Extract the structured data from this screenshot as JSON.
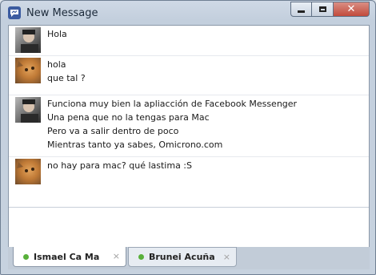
{
  "window": {
    "title": "New Message"
  },
  "window_controls": {
    "close_label": "✕"
  },
  "messages": [
    {
      "avatar": "person",
      "lines": [
        "Hola"
      ]
    },
    {
      "avatar": "cat",
      "lines": [
        "hola",
        "que tal ?"
      ]
    },
    {
      "avatar": "person",
      "lines": [
        "Funciona muy bien la apliacción de Facebook Messenger",
        "Una pena que no la tengas para Mac",
        "Pero va a salir dentro de poco",
        "Mientras tanto ya sabes, Omicrono.com"
      ]
    },
    {
      "avatar": "cat",
      "lines": [
        "no hay para mac? qué lastima :S"
      ]
    }
  ],
  "tabs": [
    {
      "label": "Ismael Ca Ma",
      "status": "online",
      "close": "×"
    },
    {
      "label": "Brunei Acuña",
      "status": "online",
      "close": "×"
    }
  ],
  "colors": {
    "online_dot": "#58b03a",
    "brand": "#3b5ba0"
  }
}
